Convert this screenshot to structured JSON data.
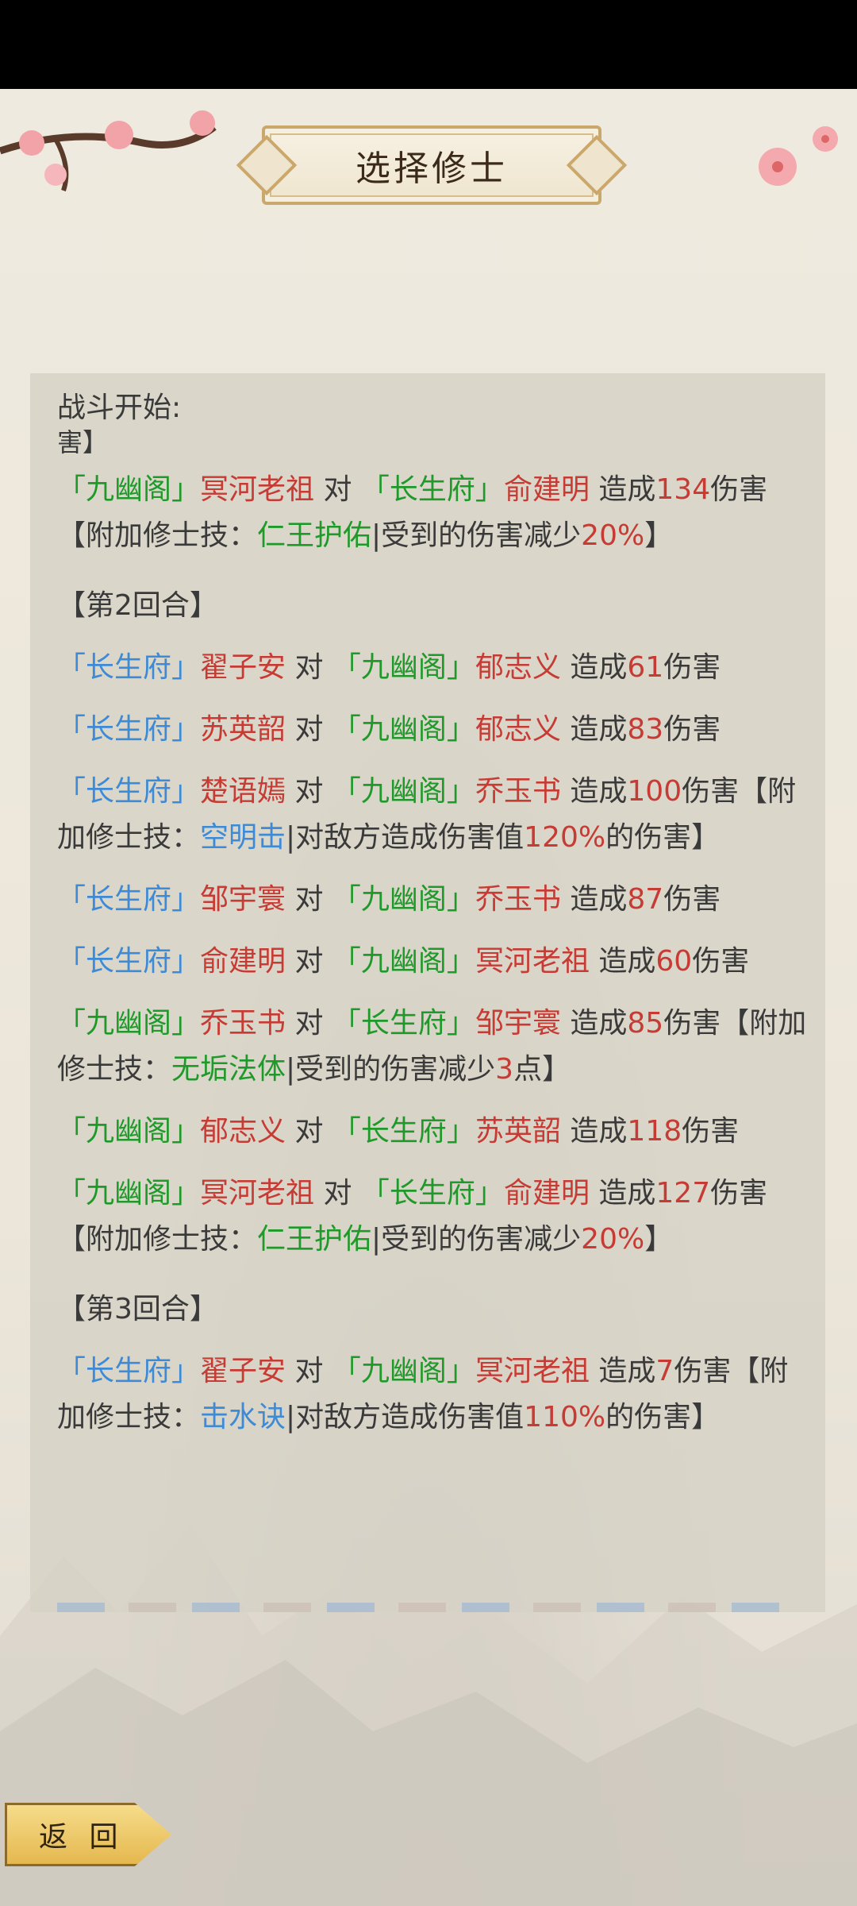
{
  "header": {
    "title": "选择修士"
  },
  "log": {
    "heading": "战斗开始:",
    "fragment": "害】",
    "entries": [
      {
        "type": "line",
        "segments": [
          {
            "text": "「九幽阁」",
            "color": "green"
          },
          {
            "text": "冥河老祖",
            "color": "red"
          },
          {
            "text": " 对 ",
            "color": "dark"
          },
          {
            "text": "「长生府」",
            "color": "green"
          },
          {
            "text": "俞建明",
            "color": "red"
          },
          {
            "text": " 造成",
            "color": "dark"
          },
          {
            "text": "134",
            "color": "red"
          },
          {
            "text": "伤害【附加修士技：",
            "color": "dark"
          },
          {
            "text": "仁王护佑",
            "color": "green"
          },
          {
            "text": "|受到的伤害减少",
            "color": "dark"
          },
          {
            "text": "20%",
            "color": "red"
          },
          {
            "text": "】",
            "color": "dark"
          }
        ]
      },
      {
        "type": "round",
        "segments": [
          {
            "text": "【第2回合】",
            "color": "dark"
          }
        ]
      },
      {
        "type": "line",
        "segments": [
          {
            "text": "「长生府」",
            "color": "blue"
          },
          {
            "text": "翟子安",
            "color": "red"
          },
          {
            "text": " 对 ",
            "color": "dark"
          },
          {
            "text": "「九幽阁」",
            "color": "green"
          },
          {
            "text": "郁志义",
            "color": "red"
          },
          {
            "text": " 造成",
            "color": "dark"
          },
          {
            "text": "61",
            "color": "red"
          },
          {
            "text": "伤害",
            "color": "dark"
          }
        ]
      },
      {
        "type": "line",
        "segments": [
          {
            "text": "「长生府」",
            "color": "blue"
          },
          {
            "text": "苏英韶",
            "color": "red"
          },
          {
            "text": " 对 ",
            "color": "dark"
          },
          {
            "text": "「九幽阁」",
            "color": "green"
          },
          {
            "text": "郁志义",
            "color": "red"
          },
          {
            "text": " 造成",
            "color": "dark"
          },
          {
            "text": "83",
            "color": "red"
          },
          {
            "text": "伤害",
            "color": "dark"
          }
        ]
      },
      {
        "type": "line",
        "segments": [
          {
            "text": "「长生府」",
            "color": "blue"
          },
          {
            "text": "楚语嫣",
            "color": "red"
          },
          {
            "text": " 对 ",
            "color": "dark"
          },
          {
            "text": "「九幽阁」",
            "color": "green"
          },
          {
            "text": "乔玉书",
            "color": "red"
          },
          {
            "text": " 造成",
            "color": "dark"
          },
          {
            "text": "100",
            "color": "red"
          },
          {
            "text": "伤害【附加修士技：",
            "color": "dark"
          },
          {
            "text": "空明击",
            "color": "blue"
          },
          {
            "text": "|对敌方造成伤害值",
            "color": "dark"
          },
          {
            "text": "120%",
            "color": "red"
          },
          {
            "text": "的伤害】",
            "color": "dark"
          }
        ]
      },
      {
        "type": "line",
        "segments": [
          {
            "text": "「长生府」",
            "color": "blue"
          },
          {
            "text": "邹宇寰",
            "color": "red"
          },
          {
            "text": " 对 ",
            "color": "dark"
          },
          {
            "text": "「九幽阁」",
            "color": "green"
          },
          {
            "text": "乔玉书",
            "color": "red"
          },
          {
            "text": " 造成",
            "color": "dark"
          },
          {
            "text": "87",
            "color": "red"
          },
          {
            "text": "伤害",
            "color": "dark"
          }
        ]
      },
      {
        "type": "line",
        "segments": [
          {
            "text": "「长生府」",
            "color": "blue"
          },
          {
            "text": "俞建明",
            "color": "red"
          },
          {
            "text": " 对 ",
            "color": "dark"
          },
          {
            "text": "「九幽阁」",
            "color": "green"
          },
          {
            "text": "冥河老祖",
            "color": "red"
          },
          {
            "text": " 造成",
            "color": "dark"
          },
          {
            "text": "60",
            "color": "red"
          },
          {
            "text": "伤害",
            "color": "dark"
          }
        ]
      },
      {
        "type": "line",
        "segments": [
          {
            "text": "「九幽阁」",
            "color": "green"
          },
          {
            "text": "乔玉书",
            "color": "red"
          },
          {
            "text": " 对 ",
            "color": "dark"
          },
          {
            "text": "「长生府」",
            "color": "green"
          },
          {
            "text": "邹宇寰",
            "color": "red"
          },
          {
            "text": " 造成",
            "color": "dark"
          },
          {
            "text": "85",
            "color": "red"
          },
          {
            "text": "伤害【附加修士技：",
            "color": "dark"
          },
          {
            "text": "无垢法体",
            "color": "green"
          },
          {
            "text": "|受到的伤害减少",
            "color": "dark"
          },
          {
            "text": "3",
            "color": "red"
          },
          {
            "text": "点】",
            "color": "dark"
          }
        ]
      },
      {
        "type": "line",
        "segments": [
          {
            "text": "「九幽阁」",
            "color": "green"
          },
          {
            "text": "郁志义",
            "color": "red"
          },
          {
            "text": " 对 ",
            "color": "dark"
          },
          {
            "text": "「长生府」",
            "color": "green"
          },
          {
            "text": "苏英韶",
            "color": "red"
          },
          {
            "text": " 造成",
            "color": "dark"
          },
          {
            "text": "118",
            "color": "red"
          },
          {
            "text": "伤害",
            "color": "dark"
          }
        ]
      },
      {
        "type": "line",
        "segments": [
          {
            "text": "「九幽阁」",
            "color": "green"
          },
          {
            "text": "冥河老祖",
            "color": "red"
          },
          {
            "text": " 对 ",
            "color": "dark"
          },
          {
            "text": "「长生府」",
            "color": "green"
          },
          {
            "text": "俞建明",
            "color": "red"
          },
          {
            "text": " 造成",
            "color": "dark"
          },
          {
            "text": "127",
            "color": "red"
          },
          {
            "text": "伤害【附加修士技：",
            "color": "dark"
          },
          {
            "text": "仁王护佑",
            "color": "green"
          },
          {
            "text": "|受到的伤害减少",
            "color": "dark"
          },
          {
            "text": "20%",
            "color": "red"
          },
          {
            "text": "】",
            "color": "dark"
          }
        ]
      },
      {
        "type": "round",
        "segments": [
          {
            "text": "【第3回合】",
            "color": "dark"
          }
        ]
      },
      {
        "type": "line",
        "segments": [
          {
            "text": "「长生府」",
            "color": "blue"
          },
          {
            "text": "翟子安",
            "color": "red"
          },
          {
            "text": " 对 ",
            "color": "dark"
          },
          {
            "text": "「九幽阁」",
            "color": "green"
          },
          {
            "text": "冥河老祖",
            "color": "red"
          },
          {
            "text": " 造成",
            "color": "dark"
          },
          {
            "text": "7",
            "color": "red"
          },
          {
            "text": "伤害【附加修士技：",
            "color": "dark"
          },
          {
            "text": "击水诀",
            "color": "blue"
          },
          {
            "text": "|对敌方造成伤害值",
            "color": "dark"
          },
          {
            "text": "110%",
            "color": "red"
          },
          {
            "text": "的伤害】",
            "color": "dark"
          }
        ]
      }
    ]
  },
  "footer": {
    "back_label": "返 回"
  },
  "colors": {
    "green": "#1f9a2a",
    "blue": "#3d8ad6",
    "red": "#c63b34",
    "dark": "#3a3a3a"
  },
  "icons": {
    "decor_left": "plum-blossom-branch-icon",
    "decor_right": "plum-blossom-icon"
  }
}
